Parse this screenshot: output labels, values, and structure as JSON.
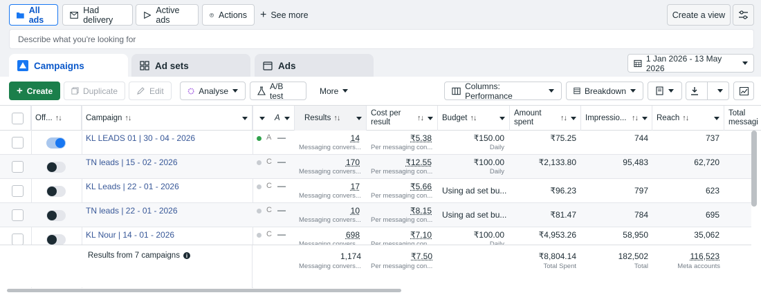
{
  "filters": {
    "all_ads": "All ads",
    "had_delivery": "Had delivery",
    "active_ads": "Active ads",
    "actions": "Actions",
    "see_more": "See more",
    "create_view": "Create a view"
  },
  "search": {
    "placeholder": "Describe what you're looking for"
  },
  "tabs": {
    "campaigns": "Campaigns",
    "ad_sets": "Ad sets",
    "ads": "Ads"
  },
  "date_range": "1 Jan 2026 - 13 May 2026",
  "toolbar": {
    "create": "Create",
    "duplicate": "Duplicate",
    "edit": "Edit",
    "analyse": "Analyse",
    "ab_test": "A/B test",
    "more": "More",
    "columns": "Columns: Performance",
    "breakdown": "Breakdown"
  },
  "columns": {
    "off": "Off...",
    "campaign": "Campaign",
    "attr": "A",
    "results": "Results",
    "cost_per_result_1": "Cost per",
    "cost_per_result_2": "result",
    "budget": "Budget",
    "amount_spent_1": "Amount",
    "amount_spent_2": "spent",
    "impressions": "Impressio...",
    "reach": "Reach",
    "total_msg_1": "Total",
    "total_msg_2": "messagi"
  },
  "rows": [
    {
      "on": true,
      "name": "KL LEADS 01 | 30 - 04 - 2026",
      "status_clip": "A",
      "results": "14",
      "results_sub": "Messaging convers...",
      "cost": "₹5.38",
      "cost_sub": "Per messaging con...",
      "budget": "₹150.00",
      "budget_sub": "Daily",
      "spent": "₹75.25",
      "impressions": "744",
      "reach": "737"
    },
    {
      "on": false,
      "name": "TN leads | 15 - 02 - 2026",
      "status_clip": "C",
      "results": "170",
      "results_sub": "Messaging convers...",
      "cost": "₹12.55",
      "cost_sub": "Per messaging con...",
      "budget": "₹100.00",
      "budget_sub": "Daily",
      "spent": "₹2,133.80",
      "impressions": "95,483",
      "reach": "62,720"
    },
    {
      "on": false,
      "name": "KL Leads | 22 - 01 - 2026",
      "status_clip": "C",
      "results": "17",
      "results_sub": "Messaging convers...",
      "cost": "₹5.66",
      "cost_sub": "Per messaging con...",
      "budget": "Using ad set bu...",
      "budget_sub": "",
      "spent": "₹96.23",
      "impressions": "797",
      "reach": "623"
    },
    {
      "on": false,
      "name": "TN leads | 22 - 01 - 2026",
      "status_clip": "C",
      "results": "10",
      "results_sub": "Messaging convers...",
      "cost": "₹8.15",
      "cost_sub": "Per messaging con...",
      "budget": "Using ad set bu...",
      "budget_sub": "",
      "spent": "₹81.47",
      "impressions": "784",
      "reach": "695"
    },
    {
      "on": false,
      "name": "KL Nour | 14 - 01 - 2026",
      "status_clip": "C",
      "results": "698",
      "results_sub": "Messaging convers...",
      "cost": "₹7.10",
      "cost_sub": "Per messaging con...",
      "budget": "₹100.00",
      "budget_sub": "Daily",
      "spent": "₹4,953.26",
      "impressions": "58,950",
      "reach": "35,062"
    }
  ],
  "totals": {
    "label": "Results from 7 campaigns",
    "results": "1,174",
    "results_sub": "Messaging convers...",
    "cost": "₹7.50",
    "cost_sub": "Per messaging con...",
    "spent": "₹8,804.14",
    "spent_sub": "Total Spent",
    "impressions": "182,502",
    "impressions_sub": "Total",
    "reach": "116,523",
    "reach_sub": "Meta accounts"
  }
}
